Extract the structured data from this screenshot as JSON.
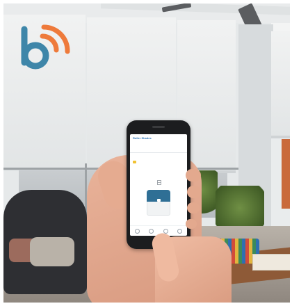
{
  "logo": {
    "icon": "b-wifi-logo-icon",
    "colors": {
      "b": "#3e86a9",
      "waves": "#ee7a3b"
    }
  },
  "app": {
    "title": "Roller Shades",
    "subtitle": "",
    "status_text": "",
    "shade_icon": "window-shade-icon",
    "nav_icons": [
      "home-icon",
      "scenes-icon",
      "schedule-icon",
      "settings-icon"
    ],
    "accent": "#2b73b6",
    "shade_color": "#2f6f95"
  },
  "scene": {
    "description_icons": [
      "ceiling-fan",
      "roller-shades",
      "armchair",
      "table",
      "plants"
    ]
  }
}
